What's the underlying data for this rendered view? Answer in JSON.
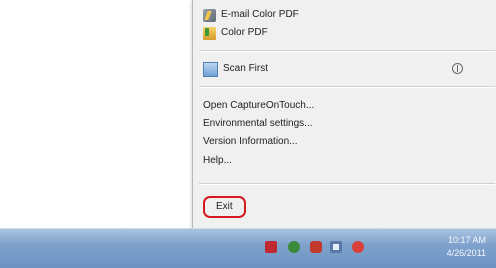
{
  "context_menu": {
    "items_top": [
      {
        "label": "E-mail Color PDF",
        "icon": "email-pdf-icon"
      },
      {
        "label": "Color PDF",
        "icon": "color-pdf-icon"
      }
    ],
    "scan_first": {
      "label": "Scan First",
      "icon": "scan-icon",
      "badge_icon": "power-icon"
    },
    "items_middle": [
      {
        "label": "Open CaptureOnTouch..."
      },
      {
        "label": "Environmental settings..."
      },
      {
        "label": "Version Information..."
      },
      {
        "label": "Help..."
      }
    ],
    "exit": {
      "label": "Exit",
      "highlight_color": "#d4191f"
    }
  },
  "taskbar": {
    "tray_icons": [
      "app-icon-red",
      "app-icon-green",
      "app-icon-red-2",
      "network-icon",
      "app-icon-red-round"
    ],
    "clock_time": "10:17 AM",
    "clock_date": "4/26/2011"
  }
}
